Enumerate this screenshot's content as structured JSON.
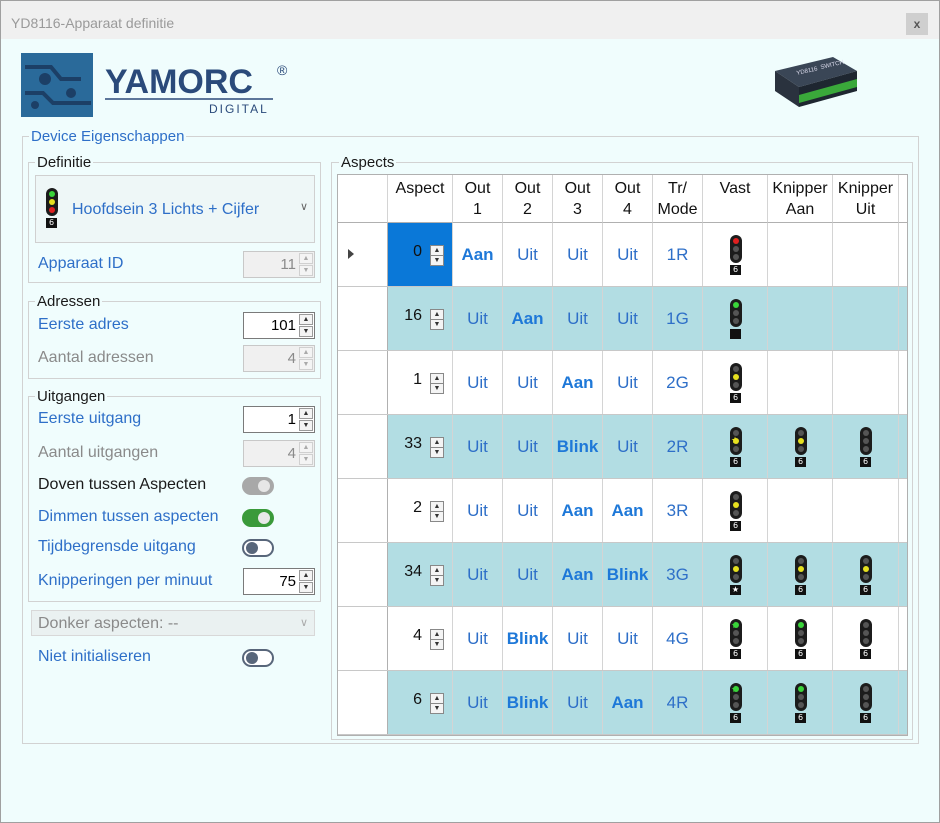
{
  "window": {
    "title": "YD8116-Apparaat definitie",
    "close_label": "x"
  },
  "logo": {
    "brand": "YAMORC",
    "registered": "®",
    "sub": "DIGITAL"
  },
  "device_image": {
    "label1": "YD8116",
    "label2": "SWITCH"
  },
  "device_props": {
    "title": "Device Eigenschappen",
    "definitie": {
      "title": "Definitie",
      "selected": "Hoofdsein 3 Lichts + Cijfer",
      "badge": "6",
      "apparaat_id_label": "Apparaat ID",
      "apparaat_id": "11"
    },
    "adressen": {
      "title": "Adressen",
      "eerste_adres_label": "Eerste adres",
      "eerste_adres": "101",
      "aantal_label": "Aantal adressen",
      "aantal": "4"
    },
    "uitgangen": {
      "title": "Uitgangen",
      "eerste_label": "Eerste uitgang",
      "eerste": "1",
      "aantal_label": "Aantal uitgangen",
      "aantal": "4",
      "doven_label": "Doven tussen Aspecten",
      "dimmen_label": "Dimmen tussen aspecten",
      "tijd_label": "Tijdbegrensde uitgang",
      "knip_label": "Knipperingen per minuut",
      "knip": "75"
    },
    "donker_label": "Donker aspecten: --",
    "niet_init_label": "Niet initialiseren"
  },
  "aspects": {
    "title": "Aspects",
    "headers": [
      {
        "l1": "Aspect",
        "l2": ""
      },
      {
        "l1": "Out",
        "l2": "1"
      },
      {
        "l1": "Out",
        "l2": "2"
      },
      {
        "l1": "Out",
        "l2": "3"
      },
      {
        "l1": "Out",
        "l2": "4"
      },
      {
        "l1": "Tr/",
        "l2": "Mode"
      },
      {
        "l1": "Vast",
        "l2": ""
      },
      {
        "l1": "Knipper",
        "l2": "Aan"
      },
      {
        "l1": "Knipper",
        "l2": "Uit"
      }
    ],
    "rows": [
      {
        "aspect": "0",
        "outs": [
          "Aan",
          "Uit",
          "Uit",
          "Uit"
        ],
        "mode": "1R",
        "vast": {
          "lamp": "red",
          "num": "6"
        },
        "kaan": null,
        "kuit": null
      },
      {
        "aspect": "16",
        "outs": [
          "Uit",
          "Aan",
          "Uit",
          "Uit"
        ],
        "mode": "1G",
        "vast": {
          "lamp": "green",
          "num": ""
        },
        "kaan": null,
        "kuit": null
      },
      {
        "aspect": "1",
        "outs": [
          "Uit",
          "Uit",
          "Aan",
          "Uit"
        ],
        "mode": "2G",
        "vast": {
          "lamp": "yellow",
          "num": "6"
        },
        "kaan": null,
        "kuit": null
      },
      {
        "aspect": "33",
        "outs": [
          "Uit",
          "Uit",
          "Blink",
          "Uit"
        ],
        "mode": "2R",
        "vast": {
          "lamp": "yellowstar",
          "num": "6"
        },
        "kaan": {
          "lamp": "yellow",
          "num": "6"
        },
        "kuit": {
          "lamp": "none",
          "num": "6"
        }
      },
      {
        "aspect": "2",
        "outs": [
          "Uit",
          "Uit",
          "Aan",
          "Aan"
        ],
        "mode": "3R",
        "vast": {
          "lamp": "yellow",
          "num": "6"
        },
        "kaan": null,
        "kuit": null
      },
      {
        "aspect": "34",
        "outs": [
          "Uit",
          "Uit",
          "Aan",
          "Blink"
        ],
        "mode": "3G",
        "vast": {
          "lamp": "yellow",
          "num": "★"
        },
        "kaan": {
          "lamp": "yellow",
          "num": "6"
        },
        "kuit": {
          "lamp": "yellow",
          "num": "6"
        }
      },
      {
        "aspect": "4",
        "outs": [
          "Uit",
          "Blink",
          "Uit",
          "Uit"
        ],
        "mode": "4G",
        "vast": {
          "lamp": "greenstar",
          "num": "6"
        },
        "kaan": {
          "lamp": "green",
          "num": "6"
        },
        "kuit": {
          "lamp": "none",
          "num": "6"
        }
      },
      {
        "aspect": "6",
        "outs": [
          "Uit",
          "Blink",
          "Uit",
          "Aan"
        ],
        "mode": "4R",
        "vast": {
          "lamp": "greenstar",
          "num": "6"
        },
        "kaan": {
          "lamp": "green",
          "num": "6"
        },
        "kuit": {
          "lamp": "none",
          "num": "6"
        }
      }
    ]
  },
  "colors": {
    "accent": "#2e6fc8",
    "row_alt": "#b2dde3",
    "selected": "#0a78d8",
    "toggle_on": "#3a9a3a"
  }
}
